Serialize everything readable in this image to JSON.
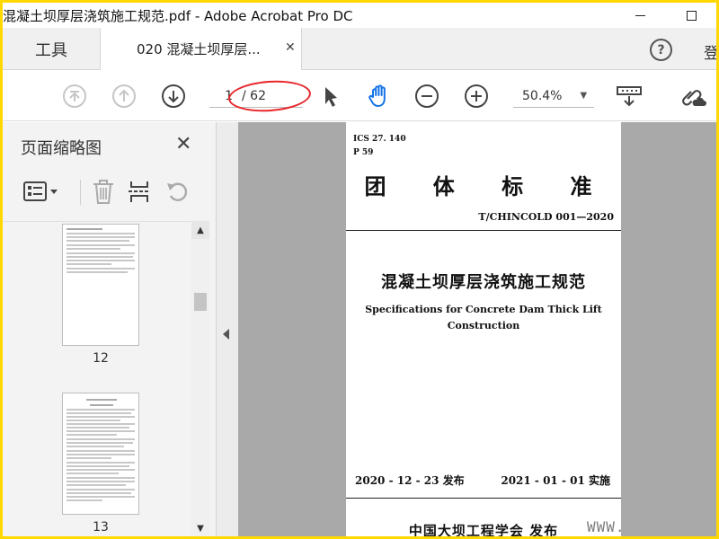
{
  "window": {
    "title": "混凝土坝厚层浇筑施工规范.pdf - Adobe Acrobat Pro DC"
  },
  "tabs": {
    "tools_label": "工具",
    "doc_tab_label": "020 混凝土坝厚层...",
    "help_label": "?",
    "login_label": "登"
  },
  "toolbar": {
    "current_page": "1",
    "total_pages": "/ 62",
    "zoom": "50.4%"
  },
  "panel": {
    "title": "页面缩略图",
    "thumbnails": [
      {
        "label": "12"
      },
      {
        "label": "13"
      }
    ]
  },
  "document": {
    "ics": "ICS 27. 140",
    "pcode": "P 59",
    "std_title": "团 体 标 准",
    "std_no": "T/CHINCOLD 001—2020",
    "cn_title": "混凝土坝厚层浇筑施工规范",
    "en_title_line1": "Specifications for Concrete Dam Thick Lift",
    "en_title_line2": "Construction",
    "issue_date": "2020 - 12 - 23 发布",
    "impl_date": "2021 - 01 - 01 实施",
    "publisher": "中国大坝工程学会  发布"
  },
  "watermark": "WWW.",
  "colors": {
    "accent_blue": "#1473e6",
    "annotation_red": "#e8262b",
    "frame_yellow": "#ffd800"
  }
}
